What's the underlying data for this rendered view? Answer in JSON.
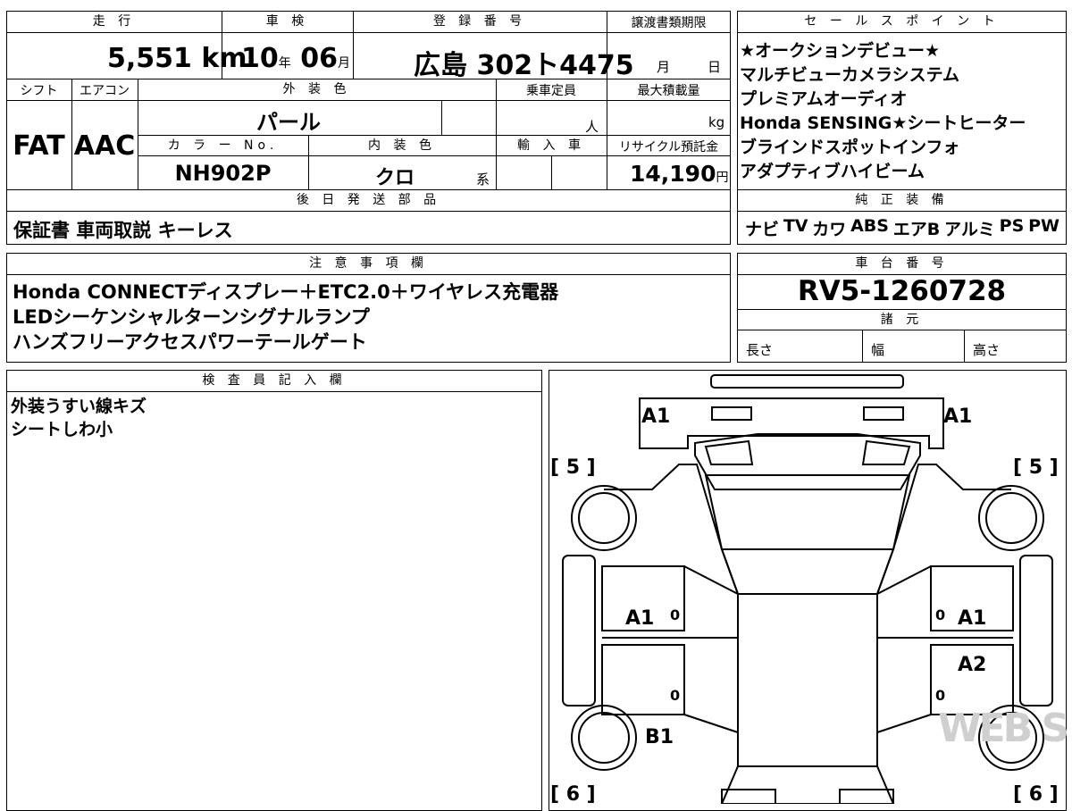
{
  "top_box": {
    "header_mileage": "走 行",
    "header_inspection": "車 検",
    "header_registration": "登 録 番 号",
    "header_transfer_deadline": "譲渡書類期限",
    "mileage_value": "5,551",
    "mileage_unit": "km",
    "inspection_year": "10",
    "inspection_year_unit": "年",
    "inspection_month": "06",
    "inspection_month_unit": "月",
    "registration_number": "広島 302ト4475",
    "deadline_month_unit": "月",
    "deadline_day_unit": "日",
    "header_shift": "シフト",
    "header_aircon": "エアコン",
    "header_exterior_color": "外 装 色",
    "header_capacity": "乗車定員",
    "header_max_load": "最大積載量",
    "shift_value": "FAT",
    "aircon_value": "AAC",
    "exterior_color_value": "パール",
    "capacity_unit": "人",
    "max_load_unit": "kg",
    "header_color_no": "カ ラ ー No.",
    "header_interior_color": "内 装 色",
    "header_import": "輸 入 車",
    "header_recycle_fee": "リサイクル預託金",
    "color_no_value": "NH902P",
    "interior_color_value": "クロ",
    "interior_color_suffix": "系",
    "recycle_fee_value": "14,190",
    "recycle_fee_unit": "円",
    "header_later_parts": "後 日 発 送 部 品",
    "later_parts_value": "保証書 車両取説 キーレス"
  },
  "sales_points": {
    "header": "セ ー ル ス ポ イ ン ト",
    "lines": [
      "★オークションデビュー★",
      "マルチビューカメラシステム",
      "プレミアムオーディオ",
      "Honda SENSING★シートヒーター",
      "ブラインドスポットインフォ",
      "アダプティブハイビーム"
    ],
    "equipment_header": "純 正 装 備",
    "equipment_items": [
      "ナビ",
      "TV",
      "カワ",
      "ABS",
      "エアB",
      "アルミ",
      "PS",
      "PW"
    ]
  },
  "notes": {
    "header": "注 意 事 項 欄",
    "lines": [
      "Honda CONNECTディスプレー＋ETC2.0＋ワイヤレス充電器",
      "LEDシーケンシャルターンシグナルランプ",
      "ハンズフリーアクセスパワーテールゲート"
    ]
  },
  "chassis": {
    "header": "車 台 番 号",
    "value": "RV5-1260728",
    "spec_header": "諸 元",
    "length_label": "長さ",
    "width_label": "幅",
    "height_label": "高さ"
  },
  "inspector": {
    "header": "検 査 員 記 入 欄",
    "lines": [
      "外装うすい線キズ",
      "シートしわ小"
    ]
  },
  "diagram": {
    "front_left": "A1",
    "front_right": "A1",
    "side_left_front": "A1",
    "side_right_front": "A1",
    "side_right_rear": "A2",
    "rear_left": "B1",
    "zero": "0",
    "bracket_front_left": "[ 5 ]",
    "bracket_front_right": "[ 5 ]",
    "bracket_rear_left": "[ 6 ]",
    "bracket_rear_right": "[ 6 ]",
    "watermark": "WEB STUDIO PRO"
  }
}
